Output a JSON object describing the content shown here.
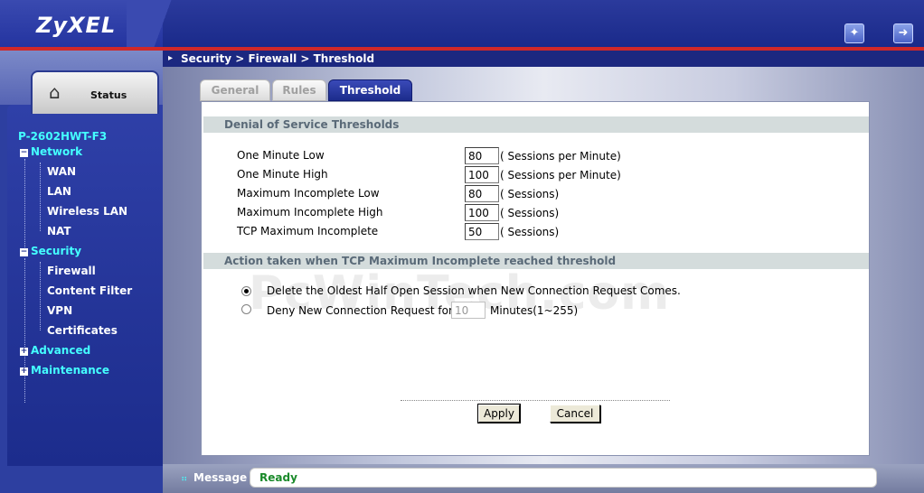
{
  "header": {
    "brand": "ZyXEL",
    "wizard_icon": "wizard-icon",
    "logout_icon": "logout-icon"
  },
  "sidebar": {
    "status_label": "Status",
    "device_name": "P-2602HWT-F3",
    "groups": [
      {
        "label": "Network",
        "expanded": true,
        "items": [
          "WAN",
          "LAN",
          "Wireless LAN",
          "NAT"
        ]
      },
      {
        "label": "Security",
        "expanded": true,
        "items": [
          "Firewall",
          "Content Filter",
          "VPN",
          "Certificates"
        ]
      },
      {
        "label": "Advanced",
        "expanded": false,
        "items": []
      },
      {
        "label": "Maintenance",
        "expanded": false,
        "items": []
      }
    ]
  },
  "main": {
    "breadcrumb": "Security > Firewall > Threshold",
    "tabs": [
      {
        "label": "General",
        "active": false
      },
      {
        "label": "Rules",
        "active": false
      },
      {
        "label": "Threshold",
        "active": true
      }
    ],
    "section1_title": "Denial of Service Thresholds",
    "thresholds": [
      {
        "label": "One Minute Low",
        "value": "80",
        "unit": "( Sessions per Minute)"
      },
      {
        "label": "One Minute High",
        "value": "100",
        "unit": "( Sessions per Minute)"
      },
      {
        "label": "Maximum Incomplete Low",
        "value": "80",
        "unit": "( Sessions)"
      },
      {
        "label": "Maximum Incomplete High",
        "value": "100",
        "unit": "( Sessions)"
      },
      {
        "label": "TCP Maximum Incomplete",
        "value": "50",
        "unit": "( Sessions)"
      }
    ],
    "section2_title": "Action taken when TCP Maximum Incomplete reached threshold",
    "option1_text": "Delete the Oldest Half Open Session when New Connection Request Comes.",
    "option2_prefix": "Deny New Connection Request for",
    "option2_value": "10",
    "option2_suffix": "Minutes(1~255)",
    "selected_option": 1,
    "apply_label": "Apply",
    "cancel_label": "Cancel",
    "watermark": "PcWinTech.com"
  },
  "statusbar": {
    "label": "Message",
    "text": "Ready",
    "text_color": "#1a8a2a"
  }
}
